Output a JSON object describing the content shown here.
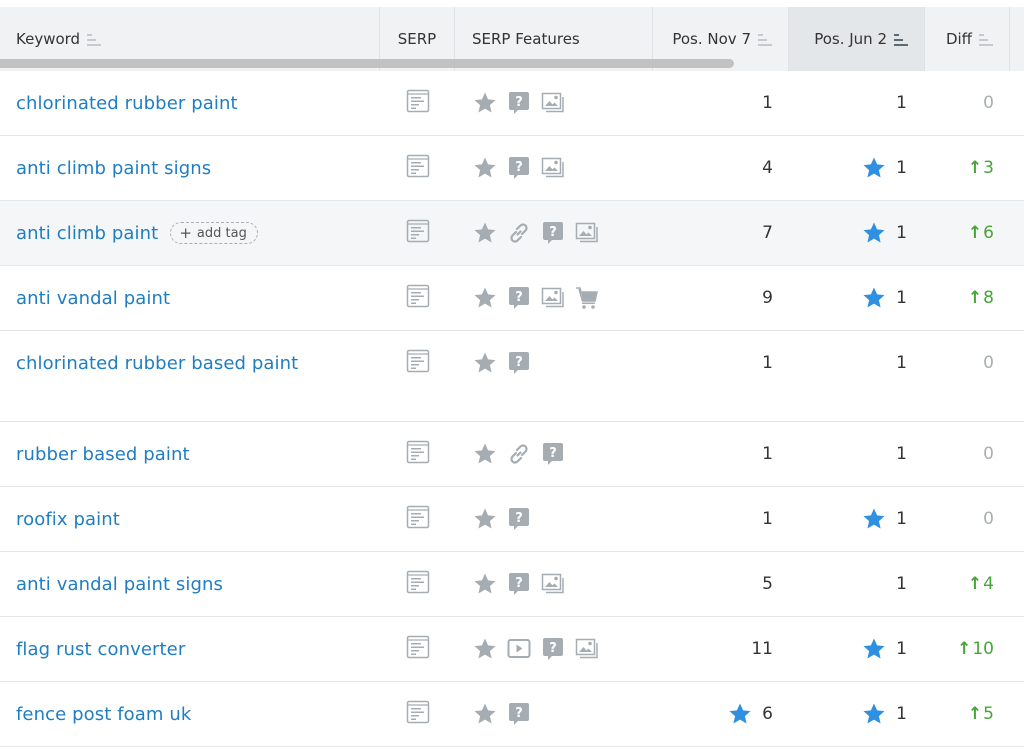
{
  "colors": {
    "link": "#1f7dc2",
    "positive": "#45a537",
    "neutral": "#a9aeb1",
    "star_highlight": "#2f8fe0",
    "icon_gray": "#a5adb2",
    "header_bg": "#f1f2f3",
    "sorted_header_bg": "#e4e7e9"
  },
  "header": {
    "columns": [
      {
        "label": "Keyword",
        "sortable": true,
        "icon": "sort-icon"
      },
      {
        "label": "SERP",
        "sortable": false
      },
      {
        "label": "SERP Features",
        "sortable": false
      },
      {
        "label": "Pos. Nov 7",
        "sortable": true,
        "icon": "sort-icon"
      },
      {
        "label": "Pos. Jun 2",
        "sortable": true,
        "icon": "sort-icon",
        "active": true
      },
      {
        "label": "Diff",
        "sortable": true,
        "icon": "sort-icon"
      }
    ]
  },
  "rows": [
    {
      "keyword": "chlorinated rubber paint",
      "features": [
        "star-icon",
        "question-icon",
        "image-icon"
      ],
      "pos_prev": "1",
      "pos_prev_star": false,
      "pos_curr": "1",
      "pos_curr_star": false,
      "diff": "0",
      "diff_dir": "none"
    },
    {
      "keyword": "anti climb paint signs",
      "features": [
        "star-icon",
        "question-icon",
        "image-icon"
      ],
      "pos_prev": "4",
      "pos_prev_star": false,
      "pos_curr": "1",
      "pos_curr_star": true,
      "diff": "3",
      "diff_dir": "up"
    },
    {
      "keyword": "anti climb paint",
      "tag_label": "add tag",
      "hover": true,
      "features": [
        "star-icon",
        "link-icon",
        "question-icon",
        "image-icon"
      ],
      "pos_prev": "7",
      "pos_prev_star": false,
      "pos_curr": "1",
      "pos_curr_star": true,
      "diff": "6",
      "diff_dir": "up"
    },
    {
      "keyword": "anti vandal paint",
      "features": [
        "star-icon",
        "question-icon",
        "image-icon",
        "cart-icon"
      ],
      "pos_prev": "9",
      "pos_prev_star": false,
      "pos_curr": "1",
      "pos_curr_star": true,
      "diff": "8",
      "diff_dir": "up"
    },
    {
      "keyword": "chlorinated rubber based paint",
      "tall": true,
      "features": [
        "star-icon",
        "question-icon"
      ],
      "pos_prev": "1",
      "pos_prev_star": false,
      "pos_curr": "1",
      "pos_curr_star": false,
      "diff": "0",
      "diff_dir": "none"
    },
    {
      "keyword": "rubber based paint",
      "features": [
        "star-icon",
        "link-icon",
        "question-icon"
      ],
      "pos_prev": "1",
      "pos_prev_star": false,
      "pos_curr": "1",
      "pos_curr_star": false,
      "diff": "0",
      "diff_dir": "none"
    },
    {
      "keyword": "roofix paint",
      "features": [
        "star-icon",
        "question-icon"
      ],
      "pos_prev": "1",
      "pos_prev_star": false,
      "pos_curr": "1",
      "pos_curr_star": true,
      "diff": "0",
      "diff_dir": "none"
    },
    {
      "keyword": "anti vandal paint signs",
      "features": [
        "star-icon",
        "question-icon",
        "image-icon"
      ],
      "pos_prev": "5",
      "pos_prev_star": false,
      "pos_curr": "1",
      "pos_curr_star": false,
      "diff": "4",
      "diff_dir": "up"
    },
    {
      "keyword": "flag rust converter",
      "features": [
        "star-icon",
        "video-icon",
        "question-icon",
        "image-icon"
      ],
      "pos_prev": "11",
      "pos_prev_star": false,
      "pos_curr": "1",
      "pos_curr_star": true,
      "diff": "10",
      "diff_dir": "up"
    },
    {
      "keyword": "fence post foam uk",
      "features": [
        "star-icon",
        "question-icon"
      ],
      "pos_prev": "6",
      "pos_prev_star": true,
      "pos_curr": "1",
      "pos_curr_star": true,
      "diff": "5",
      "diff_dir": "up"
    }
  ]
}
